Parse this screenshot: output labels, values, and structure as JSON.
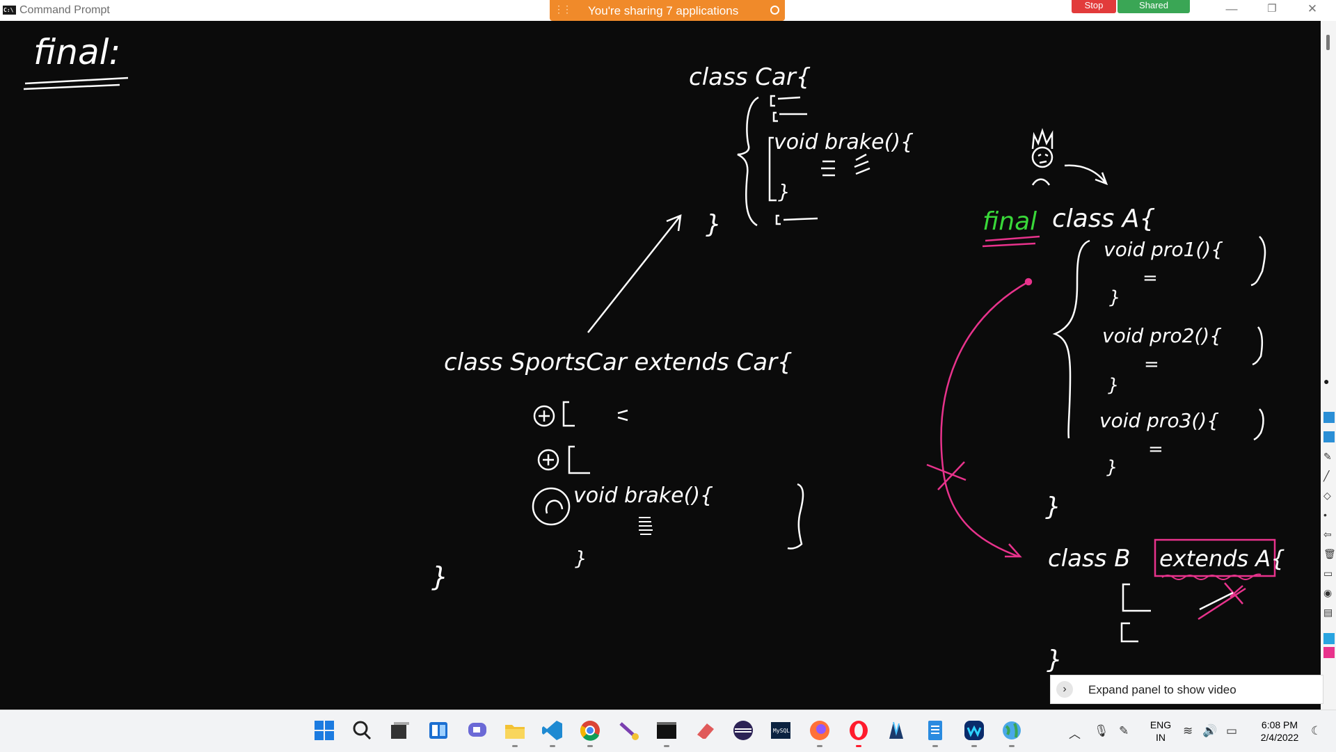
{
  "window": {
    "title": "Command Prompt",
    "app_icon_text": "C:\\",
    "sharing_banner": "You're sharing 7 applications",
    "stop_label": "Stop",
    "shared_label": "Shared",
    "controls": [
      "minimize",
      "restore",
      "close"
    ]
  },
  "whiteboard": {
    "heading": "final:",
    "car_class": {
      "header": "class Car{",
      "method": "void brake(){",
      "close": "}"
    },
    "sportscar_class": {
      "header": "class SportsCar extends Car{",
      "method": "void brake(){",
      "close": "}"
    },
    "final_class": {
      "keyword": "final",
      "header": "class A{",
      "methods": [
        "void pro1(){",
        "void pro2(){",
        "void pro3(){"
      ],
      "close": "}"
    },
    "class_b": {
      "header": "class B",
      "extends": "extends A{",
      "close": "}"
    },
    "ink_colors": {
      "white": "#ffffff",
      "green": "#39d839",
      "pink": "#e8338c"
    }
  },
  "expand_panel": {
    "label": "Expand panel to show video"
  },
  "taskbar": {
    "apps": [
      "start-icon",
      "search-icon",
      "task-view-icon",
      "widgets-icon",
      "chat-icon",
      "file-explorer-icon",
      "vscode-icon",
      "chrome-icon",
      "paint-brush-icon",
      "terminal-icon",
      "eraser-app-icon",
      "eclipse-icon",
      "mysql-icon",
      "firefox-icon",
      "opera-icon",
      "app-icon",
      "notepad-icon",
      "webex-icon",
      "globe-icon"
    ],
    "tray": {
      "language_line1": "ENG",
      "language_line2": "IN",
      "time": "6:08 PM",
      "date": "2/4/2022"
    }
  }
}
